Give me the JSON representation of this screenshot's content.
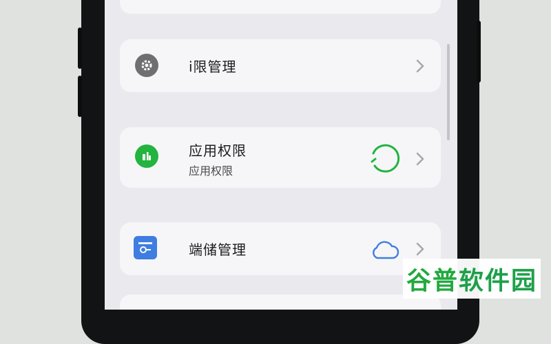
{
  "settings": {
    "items": [
      {
        "title": "\u001c限管理",
        "subtitle": "",
        "icon": "gear-icon",
        "status_icon": "",
        "title_display": "і限管理"
      },
      {
        "title": "应用权限",
        "subtitle": "应用权限",
        "icon": "app-permission-icon",
        "status_icon": "loading-ring-icon"
      },
      {
        "title": "端储管理",
        "subtitle": "",
        "icon": "storage-card-icon",
        "status_icon": "cloud-icon"
      }
    ]
  },
  "labels": {
    "item1": "і限管理",
    "item2_title": "应用权限",
    "item2_sub": "应用权限",
    "item3": "端储管理"
  },
  "watermark": {
    "part1": "谷普",
    "part2": "软件园"
  },
  "colors": {
    "accent_green": "#22b43f",
    "icon_gray": "#6f6f73",
    "icon_blue": "#3f7de0",
    "chevron": "#a5a5aa"
  }
}
